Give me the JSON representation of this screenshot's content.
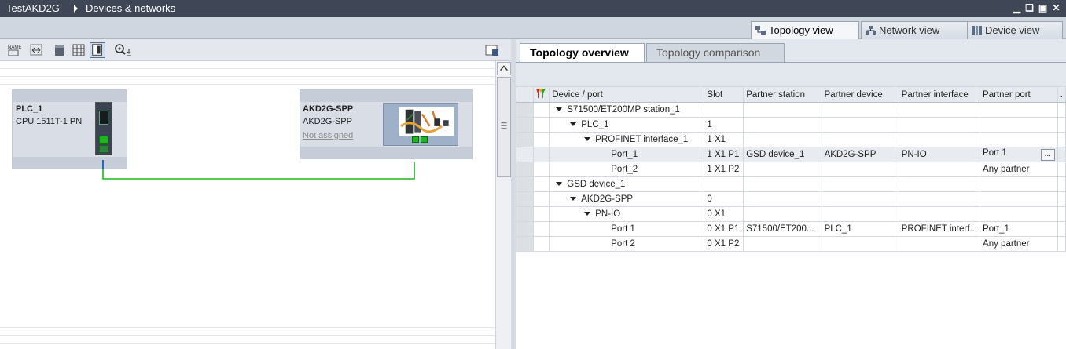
{
  "titlebar": {
    "project": "TestAKD2G",
    "editor": "Devices & networks",
    "buttons": [
      "minimize",
      "float",
      "maximize",
      "close"
    ]
  },
  "view_tabs": [
    {
      "label": "Topology view",
      "icon": "topology-view-icon",
      "active": true
    },
    {
      "label": "Network view",
      "icon": "network-view-icon",
      "active": false
    },
    {
      "label": "Device view",
      "icon": "device-view-icon",
      "active": false
    }
  ],
  "left_toolbar": {
    "icons": [
      "name-toggle-icon",
      "fit-icon",
      "page-break-icon",
      "grid-icon",
      "overview-icon",
      "zoom-icon"
    ]
  },
  "canvas": {
    "devices": [
      {
        "name": "PLC_1",
        "type": "CPU 1511T-1 PN",
        "status": ""
      },
      {
        "name": "AKD2G-SPP",
        "type": "AKD2G-SPP",
        "status": "Not assigned"
      }
    ],
    "connection_color": "#1db61d",
    "port_color": "#1db61d"
  },
  "topology_tabs": [
    {
      "label": "Topology overview",
      "active": true
    },
    {
      "label": "Topology comparison",
      "active": false
    }
  ],
  "table": {
    "columns": [
      "Device / port",
      "Slot",
      "Partner station",
      "Partner device",
      "Partner interface",
      "Partner port"
    ],
    "rows": [
      {
        "level": 0,
        "expand": true,
        "name": "S71500/ET200MP station_1",
        "slot": "",
        "partner_station": "",
        "partner_device": "",
        "partner_interface": "",
        "partner_port": ""
      },
      {
        "level": 1,
        "expand": true,
        "name": "PLC_1",
        "slot": "1",
        "partner_station": "",
        "partner_device": "",
        "partner_interface": "",
        "partner_port": ""
      },
      {
        "level": 2,
        "expand": true,
        "name": "PROFINET interface_1",
        "slot": "1 X1",
        "partner_station": "",
        "partner_device": "",
        "partner_interface": "",
        "partner_port": ""
      },
      {
        "level": 3,
        "expand": false,
        "name": "Port_1",
        "slot": "1 X1 P1",
        "partner_station": "GSD device_1",
        "partner_device": "AKD2G-SPP",
        "partner_interface": "PN-IO",
        "partner_port": "Port 1",
        "selected": true
      },
      {
        "level": 3,
        "expand": false,
        "name": "Port_2",
        "slot": "1 X1 P2",
        "partner_station": "",
        "partner_device": "",
        "partner_interface": "",
        "partner_port": "Any partner"
      },
      {
        "level": 0,
        "expand": true,
        "name": "GSD device_1",
        "slot": "",
        "partner_station": "",
        "partner_device": "",
        "partner_interface": "",
        "partner_port": ""
      },
      {
        "level": 1,
        "expand": true,
        "name": "AKD2G-SPP",
        "slot": "0",
        "partner_station": "",
        "partner_device": "",
        "partner_interface": "",
        "partner_port": ""
      },
      {
        "level": 2,
        "expand": true,
        "name": "PN-IO",
        "slot": "0 X1",
        "partner_station": "",
        "partner_device": "",
        "partner_interface": "",
        "partner_port": ""
      },
      {
        "level": 3,
        "expand": false,
        "name": "Port 1",
        "slot": "0 X1 P1",
        "partner_station": "S71500/ET200...",
        "partner_device": "PLC_1",
        "partner_interface": "PROFINET interf...",
        "partner_port": "Port_1"
      },
      {
        "level": 3,
        "expand": false,
        "name": "Port 2",
        "slot": "0 X1 P2",
        "partner_station": "",
        "partner_device": "",
        "partner_interface": "",
        "partner_port": "Any partner"
      }
    ],
    "more_button_label": "...",
    "trailing_cell": "."
  }
}
